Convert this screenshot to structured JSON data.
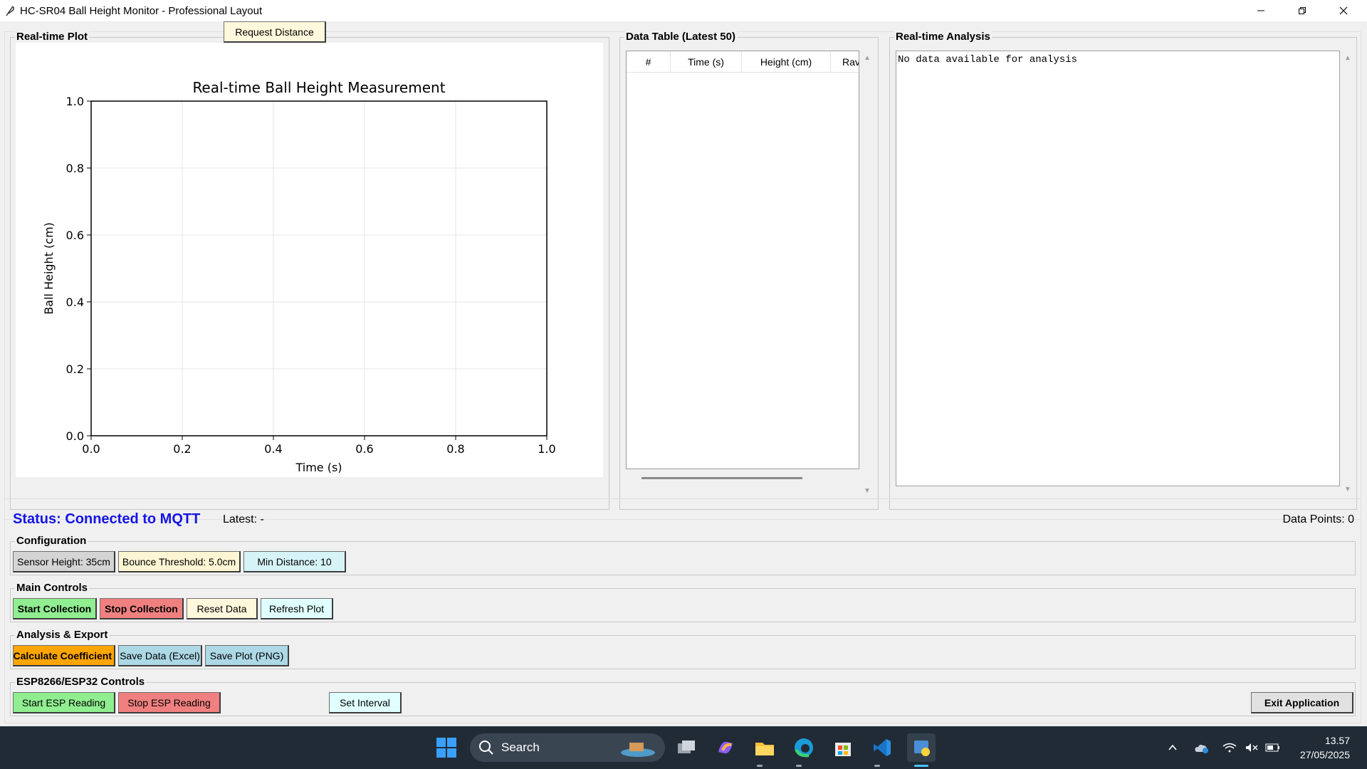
{
  "window": {
    "title": "HC-SR04 Ball Height Monitor - Professional Layout"
  },
  "plot_panel": {
    "label": "Real-time Plot"
  },
  "chart_data": {
    "type": "line",
    "title": "Real-time Ball Height Measurement",
    "xlabel": "Time (s)",
    "ylabel": "Ball Height (cm)",
    "xlim": [
      0.0,
      1.0
    ],
    "ylim": [
      0.0,
      1.0
    ],
    "xticks": [
      "0.0",
      "0.2",
      "0.4",
      "0.6",
      "0.8",
      "1.0"
    ],
    "yticks": [
      "0.0",
      "0.2",
      "0.4",
      "0.6",
      "0.8",
      "1.0"
    ],
    "grid": true,
    "series": []
  },
  "table_panel": {
    "label": "Data Table (Latest 50)",
    "columns": [
      "#",
      "Time (s)",
      "Height (cm)",
      "Rav"
    ],
    "rows": []
  },
  "analysis_panel": {
    "label": "Real-time Analysis",
    "text": "No data available for analysis"
  },
  "status": {
    "text": "Status: Connected to MQTT",
    "color": "#1414e6",
    "latest": "Latest: -",
    "data_points": "Data Points: 0"
  },
  "configuration": {
    "label": "Configuration",
    "buttons": [
      {
        "label": "Sensor Height: 35cm",
        "color": "#d4d4d4"
      },
      {
        "label": "Bounce Threshold: 5.0cm",
        "color": "#fdf5d4"
      },
      {
        "label": "Min Distance: 10",
        "color": "#d6f4f8"
      }
    ]
  },
  "main_controls": {
    "label": "Main Controls",
    "buttons": [
      {
        "label": "Start Collection",
        "color": "#90ee90"
      },
      {
        "label": "Stop Collection",
        "color": "#f08080"
      },
      {
        "label": "Reset Data",
        "color": "#fff8dc"
      },
      {
        "label": "Refresh Plot",
        "color": "#e0ffff"
      }
    ]
  },
  "analysis_export": {
    "label": "Analysis & Export",
    "buttons": [
      {
        "label": "Calculate Coefficient",
        "color": "#ffa500"
      },
      {
        "label": "Save Data (Excel)",
        "color": "#add8e6"
      },
      {
        "label": "Save Plot (PNG)",
        "color": "#add8e6"
      }
    ]
  },
  "esp_controls": {
    "label": "ESP8266/ESP32 Controls",
    "buttons": [
      {
        "label": "Start ESP Reading",
        "color": "#90ee90"
      },
      {
        "label": "Stop ESP Reading",
        "color": "#f08080"
      },
      {
        "label": "Request Distance",
        "color": "#fff8dc"
      },
      {
        "label": "Set Interval",
        "color": "#e0ffff"
      }
    ],
    "exit_label": "Exit Application"
  },
  "taskbar": {
    "search_label": "Search",
    "time": "13.57",
    "date": "27/05/2025"
  }
}
